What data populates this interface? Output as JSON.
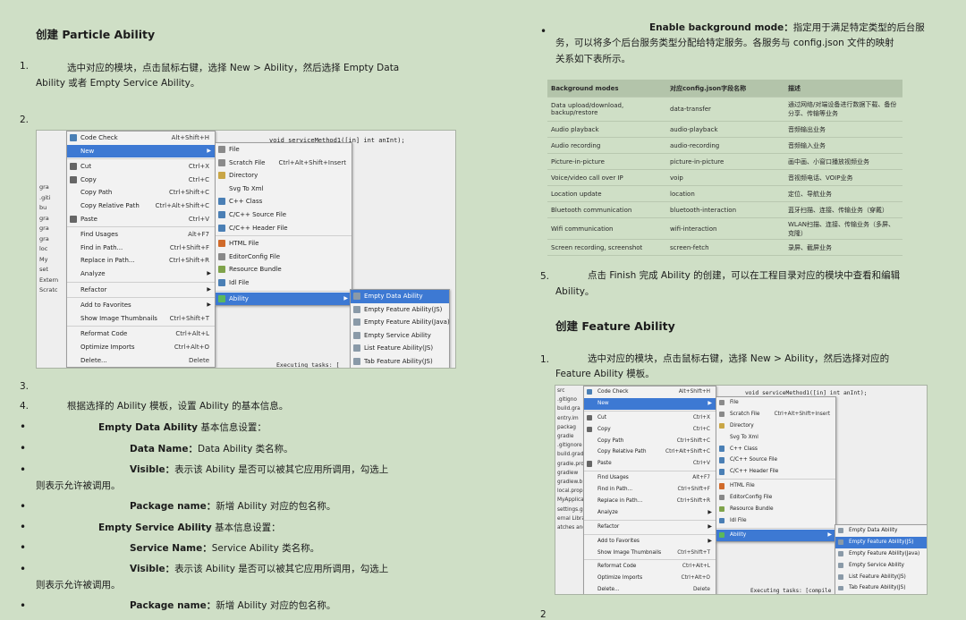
{
  "left": {
    "heading": "创建 Particle Ability",
    "step1_num": "1.",
    "step1_line1": "选中对应的模块，点击鼠标右键，选择 New > Ability，然后选择 Empty Data",
    "step1_line2": "Ability 或者 Empty Service Ability。",
    "step2_num": "2.",
    "step3_num": "3.",
    "step4_num": "4.",
    "step4_text": "根据选择的 Ability 模板，设置 Ability 的基本信息。",
    "bullets": [
      {
        "label": "Empty Data Ability",
        "text": " 基本信息设置："
      },
      {
        "label": "Data Name：",
        "text": "Data Ability 类名称。"
      },
      {
        "label": "Visible：",
        "text": "表示该 Ability 是否可以被其它应用所调用，勾选上"
      },
      {
        "label": "Package name：",
        "text": "新增 Ability 对应的包名称。"
      },
      {
        "label": "Empty Service Ability",
        "text": " 基本信息设置："
      },
      {
        "label": "Service Name：",
        "text": "Service Ability 类名称。"
      },
      {
        "label": "Visible：",
        "text": "表示该 Ability 是否可以被其它应用所调用，勾选上"
      },
      {
        "label": "Package name：",
        "text": "新增 Ability 对应的包名称。"
      }
    ],
    "visible_cont1": "则表示允许被调用。",
    "visible_cont2": "则表示允许被调用。",
    "bullet_char": "•"
  },
  "right": {
    "bg_label": "Enable background mode：",
    "bg_line1": "指定用于满足特定类型的后台服",
    "bg_line2": "务，可以将多个后台服务类型分配给特定服务。各服务与 config.json 文件的映射",
    "bg_line3": "关系如下表所示。",
    "table_headers": [
      "Background modes",
      "对应config.json字段名称",
      "描述"
    ],
    "table_rows": [
      [
        "Data upload/download, backup/restore",
        "data-transfer",
        "通过网络/对端设备进行数据下载、备份分享、传输等业务"
      ],
      [
        "Audio playback",
        "audio-playback",
        "音频输出业务"
      ],
      [
        "Audio recording",
        "audio-recording",
        "音频输入业务"
      ],
      [
        "Picture-in-picture",
        "picture-in-picture",
        "画中画、小窗口播放视频业务"
      ],
      [
        "Voice/video call over IP",
        "voip",
        "音视频电话、VOIP业务"
      ],
      [
        "Location update",
        "location",
        "定位、导航业务"
      ],
      [
        "Bluetooth communication",
        "bluetooth-interaction",
        "蓝牙扫描、连接、传输业务（穿戴）"
      ],
      [
        "Wifi communication",
        "wifi-interaction",
        "WLAN扫描、连接、传输业务（多屏、克隆）"
      ],
      [
        "Screen recording, screenshot",
        "screen-fetch",
        "录屏、截屏业务"
      ]
    ],
    "step5_num": "5.",
    "step5_line1": "点击 Finish 完成 Ability 的创建，可以在工程目录对应的模块中查看和编辑",
    "step5_line2": "Ability。",
    "heading2": "创建 Feature Ability",
    "fstep1_num": "1.",
    "fstep1_line1": "选中对应的模块，点击鼠标右键，选择 New > Ability，然后选择对应的",
    "fstep1_line2": "Feature Ability 模板。",
    "fstep2_num": "2"
  },
  "ide": {
    "code_line": "void serviceMethod1([in] int anInt);",
    "executing": "Executing tasks: [",
    "executing2": "Executing tasks: [compile",
    "tree_left": [
      "gra",
      ".giti",
      "bu",
      "gra",
      "gra",
      "gra",
      "loc",
      "My",
      "set",
      "Extern",
      "Scratc"
    ],
    "tree_right": [
      "src",
      ".gitigno",
      "build.gra",
      "entry.im",
      "packag",
      "gradle",
      ".gitignore",
      "build.grad",
      "gradle.pro",
      "gradlew",
      "gradlew.b",
      "local.prop",
      "MyApplica",
      "settings.gr",
      "ernal Librar",
      "atches and"
    ],
    "context_menu": [
      {
        "label": "Code Check",
        "shortcut": "Alt+Shift+H",
        "icon": "code-check-icon",
        "color": "#4a7fb5"
      },
      {
        "label": "New",
        "shortcut": "",
        "arrow": true,
        "selected": true
      },
      {
        "sep": true
      },
      {
        "label": "Cut",
        "shortcut": "Ctrl+X",
        "icon": "cut-icon",
        "color": "#666"
      },
      {
        "label": "Copy",
        "shortcut": "Ctrl+C",
        "icon": "copy-icon",
        "color": "#666"
      },
      {
        "label": "Copy Path",
        "shortcut": "Ctrl+Shift+C"
      },
      {
        "label": "Copy Relative Path",
        "shortcut": "Ctrl+Alt+Shift+C"
      },
      {
        "label": "Paste",
        "shortcut": "Ctrl+V",
        "icon": "paste-icon",
        "color": "#666"
      },
      {
        "sep": true
      },
      {
        "label": "Find Usages",
        "shortcut": "Alt+F7"
      },
      {
        "label": "Find in Path...",
        "shortcut": "Ctrl+Shift+F"
      },
      {
        "label": "Replace in Path...",
        "shortcut": "Ctrl+Shift+R"
      },
      {
        "label": "Analyze",
        "shortcut": "",
        "arrow": true
      },
      {
        "sep": true
      },
      {
        "label": "Refactor",
        "shortcut": "",
        "arrow": true
      },
      {
        "sep": true
      },
      {
        "label": "Add to Favorites",
        "shortcut": "",
        "arrow": true
      },
      {
        "label": "Show Image Thumbnails",
        "shortcut": "Ctrl+Shift+T"
      },
      {
        "sep": true
      },
      {
        "label": "Reformat Code",
        "shortcut": "Ctrl+Alt+L"
      },
      {
        "label": "Optimize Imports",
        "shortcut": "Ctrl+Alt+O"
      },
      {
        "label": "Delete...",
        "shortcut": "Delete"
      }
    ],
    "new_menu": [
      {
        "label": "File",
        "icon": "file-icon",
        "color": "#8a8a8a"
      },
      {
        "label": "Scratch File",
        "shortcut": "Ctrl+Alt+Shift+Insert",
        "icon": "scratch-file-icon",
        "color": "#8a8a8a"
      },
      {
        "label": "Directory",
        "icon": "directory-icon",
        "color": "#c9a646"
      },
      {
        "label": "Svg To Xml"
      },
      {
        "label": "C++ Class",
        "icon": "cpp-class-icon",
        "color": "#4a7fb5"
      },
      {
        "label": "C/C++ Source File",
        "icon": "c-source-file-icon",
        "color": "#4a7fb5"
      },
      {
        "label": "C/C++ Header File",
        "icon": "c-header-file-icon",
        "color": "#4a7fb5"
      },
      {
        "sep": true
      },
      {
        "label": "HTML File",
        "icon": "html-file-icon",
        "color": "#d06a2a"
      },
      {
        "label": "EditorConfig File",
        "icon": "editorconfig-icon",
        "color": "#888"
      },
      {
        "label": "Resource Bundle",
        "icon": "resource-bundle-icon",
        "color": "#7fa34a"
      },
      {
        "label": "Idl File",
        "icon": "idl-file-icon",
        "color": "#4a7fb5"
      },
      {
        "sep": true
      },
      {
        "label": "Ability",
        "icon": "ability-icon",
        "color": "#5cb85c",
        "arrow": true,
        "selected": true
      }
    ],
    "ability_menu": [
      "Empty Data Ability",
      "Empty Feature Ability(JS)",
      "Empty Feature Ability(Java)",
      "Empty Service Ability",
      "List Feature Ability(JS)",
      "Tab Feature Ability(JS)"
    ]
  }
}
